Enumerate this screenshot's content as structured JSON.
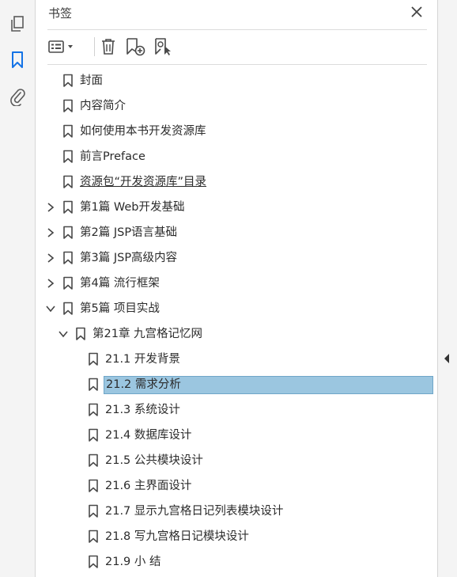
{
  "panel": {
    "title": "书签"
  },
  "left_rail": {
    "icons": [
      "pages-icon",
      "bookmarks-icon",
      "attachments-icon"
    ],
    "accent": "#1473e6"
  },
  "toolbar": {
    "buttons": [
      "options-menu-icon",
      "delete-bookmark-icon",
      "new-bookmark-icon",
      "bookmark-from-selection-icon"
    ]
  },
  "bookmarks": [
    {
      "label": "封面",
      "level": 0,
      "expander": "none"
    },
    {
      "label": "内容简介",
      "level": 0,
      "expander": "none"
    },
    {
      "label": "如何使用本书开发资源库",
      "level": 0,
      "expander": "none"
    },
    {
      "label": "前言Preface",
      "level": 0,
      "expander": "none"
    },
    {
      "label": "资源包“开发资源库”目录",
      "level": 0,
      "expander": "none",
      "underline": true
    },
    {
      "label": "第1篇 Web开发基础",
      "level": 0,
      "expander": "collapsed"
    },
    {
      "label": "第2篇 JSP语言基础",
      "level": 0,
      "expander": "collapsed"
    },
    {
      "label": "第3篇 JSP高级内容",
      "level": 0,
      "expander": "collapsed"
    },
    {
      "label": "第4篇 流行框架",
      "level": 0,
      "expander": "collapsed"
    },
    {
      "label": "第5篇 项目实战",
      "level": 0,
      "expander": "expanded"
    },
    {
      "label": "第21章 九宫格记忆网",
      "level": 1,
      "expander": "expanded"
    },
    {
      "label": "21.1 开发背景",
      "level": 2,
      "expander": "none"
    },
    {
      "label": "21.2 需求分析",
      "level": 2,
      "expander": "none",
      "selected": true
    },
    {
      "label": "21.3 系统设计",
      "level": 2,
      "expander": "none"
    },
    {
      "label": "21.4 数据库设计",
      "level": 2,
      "expander": "none"
    },
    {
      "label": "21.5 公共模块设计",
      "level": 2,
      "expander": "none"
    },
    {
      "label": "21.6 主界面设计",
      "level": 2,
      "expander": "none"
    },
    {
      "label": "21.7 显示九宫格日记列表模块设计",
      "level": 2,
      "expander": "none"
    },
    {
      "label": "21.8 写九宫格日记模块设计",
      "level": 2,
      "expander": "none"
    },
    {
      "label": "21.9 小 结",
      "level": 2,
      "expander": "none"
    }
  ],
  "colors": {
    "selection": "#9bc6e0",
    "icon": "#4a4a4a"
  }
}
